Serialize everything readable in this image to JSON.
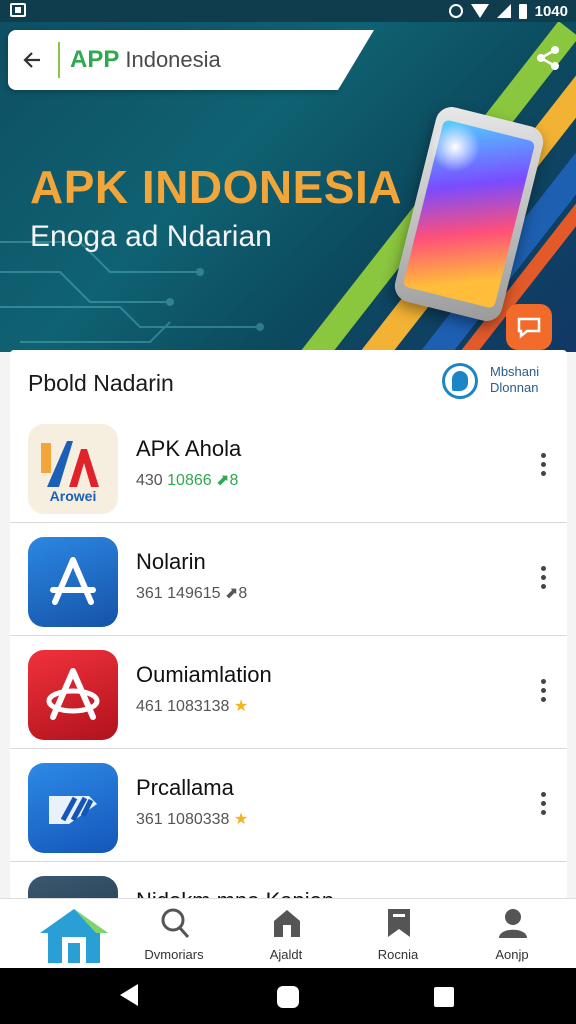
{
  "status_bar": {
    "time": "1040"
  },
  "header": {
    "brand": "APP",
    "brand_sub": "Indonesia"
  },
  "hero": {
    "title": "APK INDONESIA",
    "subtitle": "Enoga ad Ndarian"
  },
  "list": {
    "title": "Pbold Nadarin",
    "badge_text": "Mbshani Dlonnan",
    "items": [
      {
        "name": "APK Ahola",
        "meta_a": "430 ",
        "meta_b": "10866",
        "meta_c": " ⬈8",
        "icon": "apk-logo-icon",
        "icon_text": "Arowei"
      },
      {
        "name": "Nolarin",
        "meta_a": "361 149615 ",
        "meta_b": "",
        "meta_c": "⬈8",
        "icon": "app-store-icon"
      },
      {
        "name": "Oumiamlation",
        "meta_a": "461 1083138 ",
        "meta_b": "",
        "meta_c": "★",
        "icon": "red-a-icon"
      },
      {
        "name": "Prcallama",
        "meta_a": "361 1080338 ",
        "meta_b": "",
        "meta_c": "★",
        "icon": "blue-slash-icon"
      },
      {
        "name": "Nidokm mna Kapion",
        "meta_a": "",
        "meta_b": "",
        "meta_c": "",
        "icon": "mountain-icon"
      }
    ]
  },
  "bottom_nav": {
    "items": [
      {
        "label": "",
        "icon": "home-icon"
      },
      {
        "label": "Dvmoriars",
        "icon": "search-icon"
      },
      {
        "label": "Ajaldt",
        "icon": "house-icon"
      },
      {
        "label": "Rocnia",
        "icon": "bookmark-icon"
      },
      {
        "label": "Aonjp",
        "icon": "profile-icon"
      }
    ]
  },
  "colors": {
    "accent_green": "#2fa84f",
    "hero_orange": "#f2a63a",
    "hero_teal": "#0f6272"
  }
}
